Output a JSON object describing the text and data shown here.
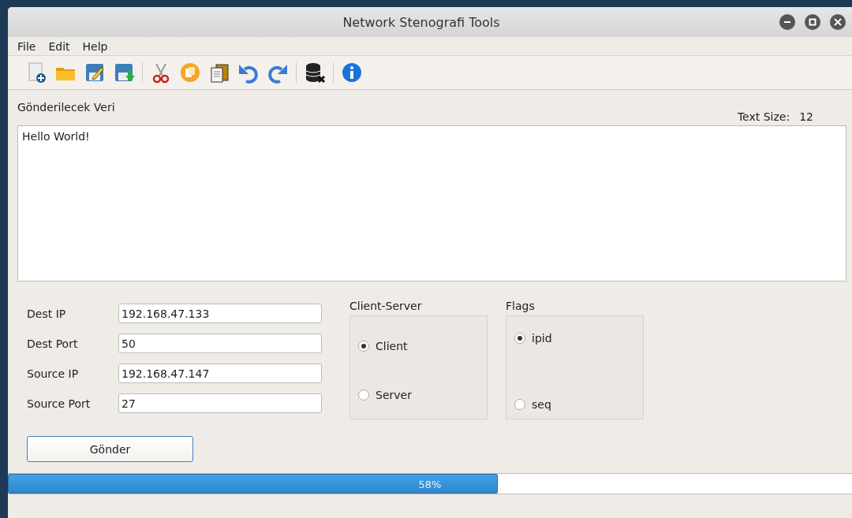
{
  "window": {
    "title": "Network Stenografi Tools"
  },
  "menu": [
    "File",
    "Edit",
    "Help"
  ],
  "data_label": "Gönderilecek Veri",
  "text_size": {
    "label": "Text Size:",
    "value": "12"
  },
  "message": {
    "value": "Hello World!"
  },
  "fields": [
    {
      "label": "Dest IP",
      "value": "192.168.47.133"
    },
    {
      "label": "Dest Port",
      "value": "50"
    },
    {
      "label": "Source IP",
      "value": "192.168.47.147"
    },
    {
      "label": "Source Port",
      "value": "27"
    }
  ],
  "send_button": "Gönder",
  "groups": [
    {
      "title": "Client-Server",
      "options": [
        {
          "label": "Client",
          "selected": true
        },
        {
          "label": "Server",
          "selected": false
        }
      ]
    },
    {
      "title": "Flags",
      "options": [
        {
          "label": "ipid",
          "selected": true
        },
        {
          "label": "seq",
          "selected": false
        }
      ]
    }
  ],
  "progress": {
    "level": 0.58,
    "text": "58%"
  }
}
